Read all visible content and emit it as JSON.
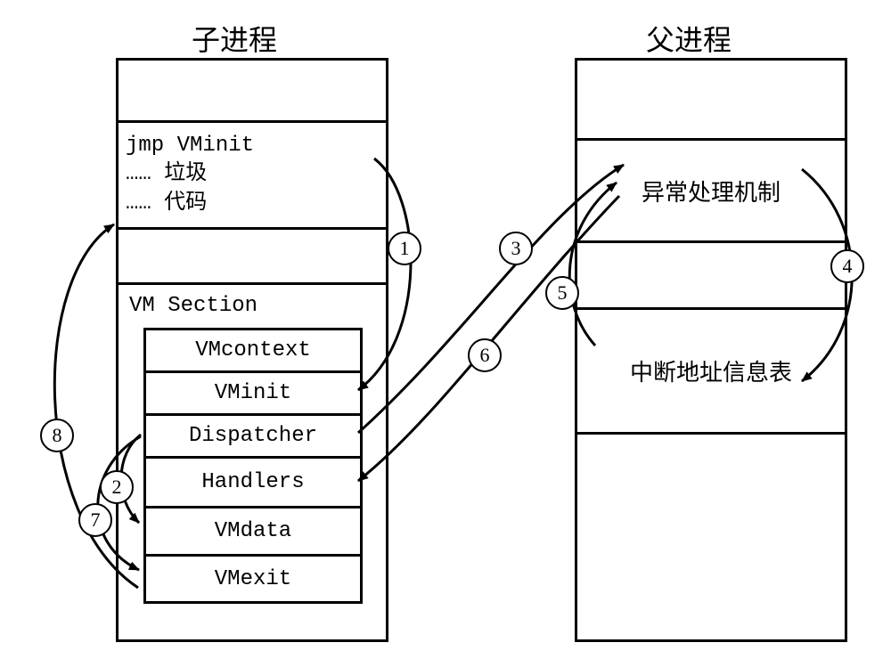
{
  "titles": {
    "child": "子进程",
    "parent": "父进程"
  },
  "child_box": {
    "codeblock": "jmp VMinit\n…… 垃圾\n…… 代码",
    "vm_section_label": "VM Section",
    "vm_items": [
      "VMcontext",
      "VMinit",
      "Dispatcher",
      "Handlers",
      "VMdata",
      "VMexit"
    ]
  },
  "parent_box": {
    "exception_handler": "异常处理机制",
    "interrupt_table": "中断地址信息表"
  },
  "steps": [
    "1",
    "2",
    "3",
    "4",
    "5",
    "6",
    "7",
    "8"
  ],
  "chart_data": {
    "type": "diagram",
    "description": "Two process columns — child process (子进程) containing a VM Section with components, and parent process (父进程) containing an exception handler and interrupt address information table. Numbered arrows (1–8) show control/data flow between them.",
    "nodes": {
      "child": {
        "label": "子进程",
        "rows": [
          "(blank)",
          "jmp VMinit / …… 垃圾 / …… 代码",
          "(blank)",
          "VM Section [VMcontext, VMinit, Dispatcher, Handlers, VMdata, VMexit]"
        ]
      },
      "parent": {
        "label": "父进程",
        "rows": [
          "(blank)",
          "异常处理机制",
          "(blank)",
          "中断地址信息表",
          "(blank)"
        ]
      }
    },
    "edges": [
      {
        "step": 1,
        "from": "child.codeblock (jmp VMinit)",
        "to": "child.VM_Section.VMinit"
      },
      {
        "step": 2,
        "from": "child.VM_Section.Dispatcher",
        "to": "child.VM_Section.VMdata"
      },
      {
        "step": 3,
        "from": "child.VM_Section.Dispatcher",
        "to": "parent.异常处理机制"
      },
      {
        "step": 4,
        "from": "parent.异常处理机制",
        "to": "parent.中断地址信息表"
      },
      {
        "step": 5,
        "from": "parent.中断地址信息表",
        "to": "parent.异常处理机制"
      },
      {
        "step": 6,
        "from": "parent.异常处理机制",
        "to": "child.VM_Section.Handlers"
      },
      {
        "step": 7,
        "from": "child.VM_Section.Dispatcher",
        "to": "child.VM_Section.VMexit"
      },
      {
        "step": 8,
        "from": "child.VM_Section.VMexit",
        "to": "child.codeblock"
      }
    ]
  }
}
